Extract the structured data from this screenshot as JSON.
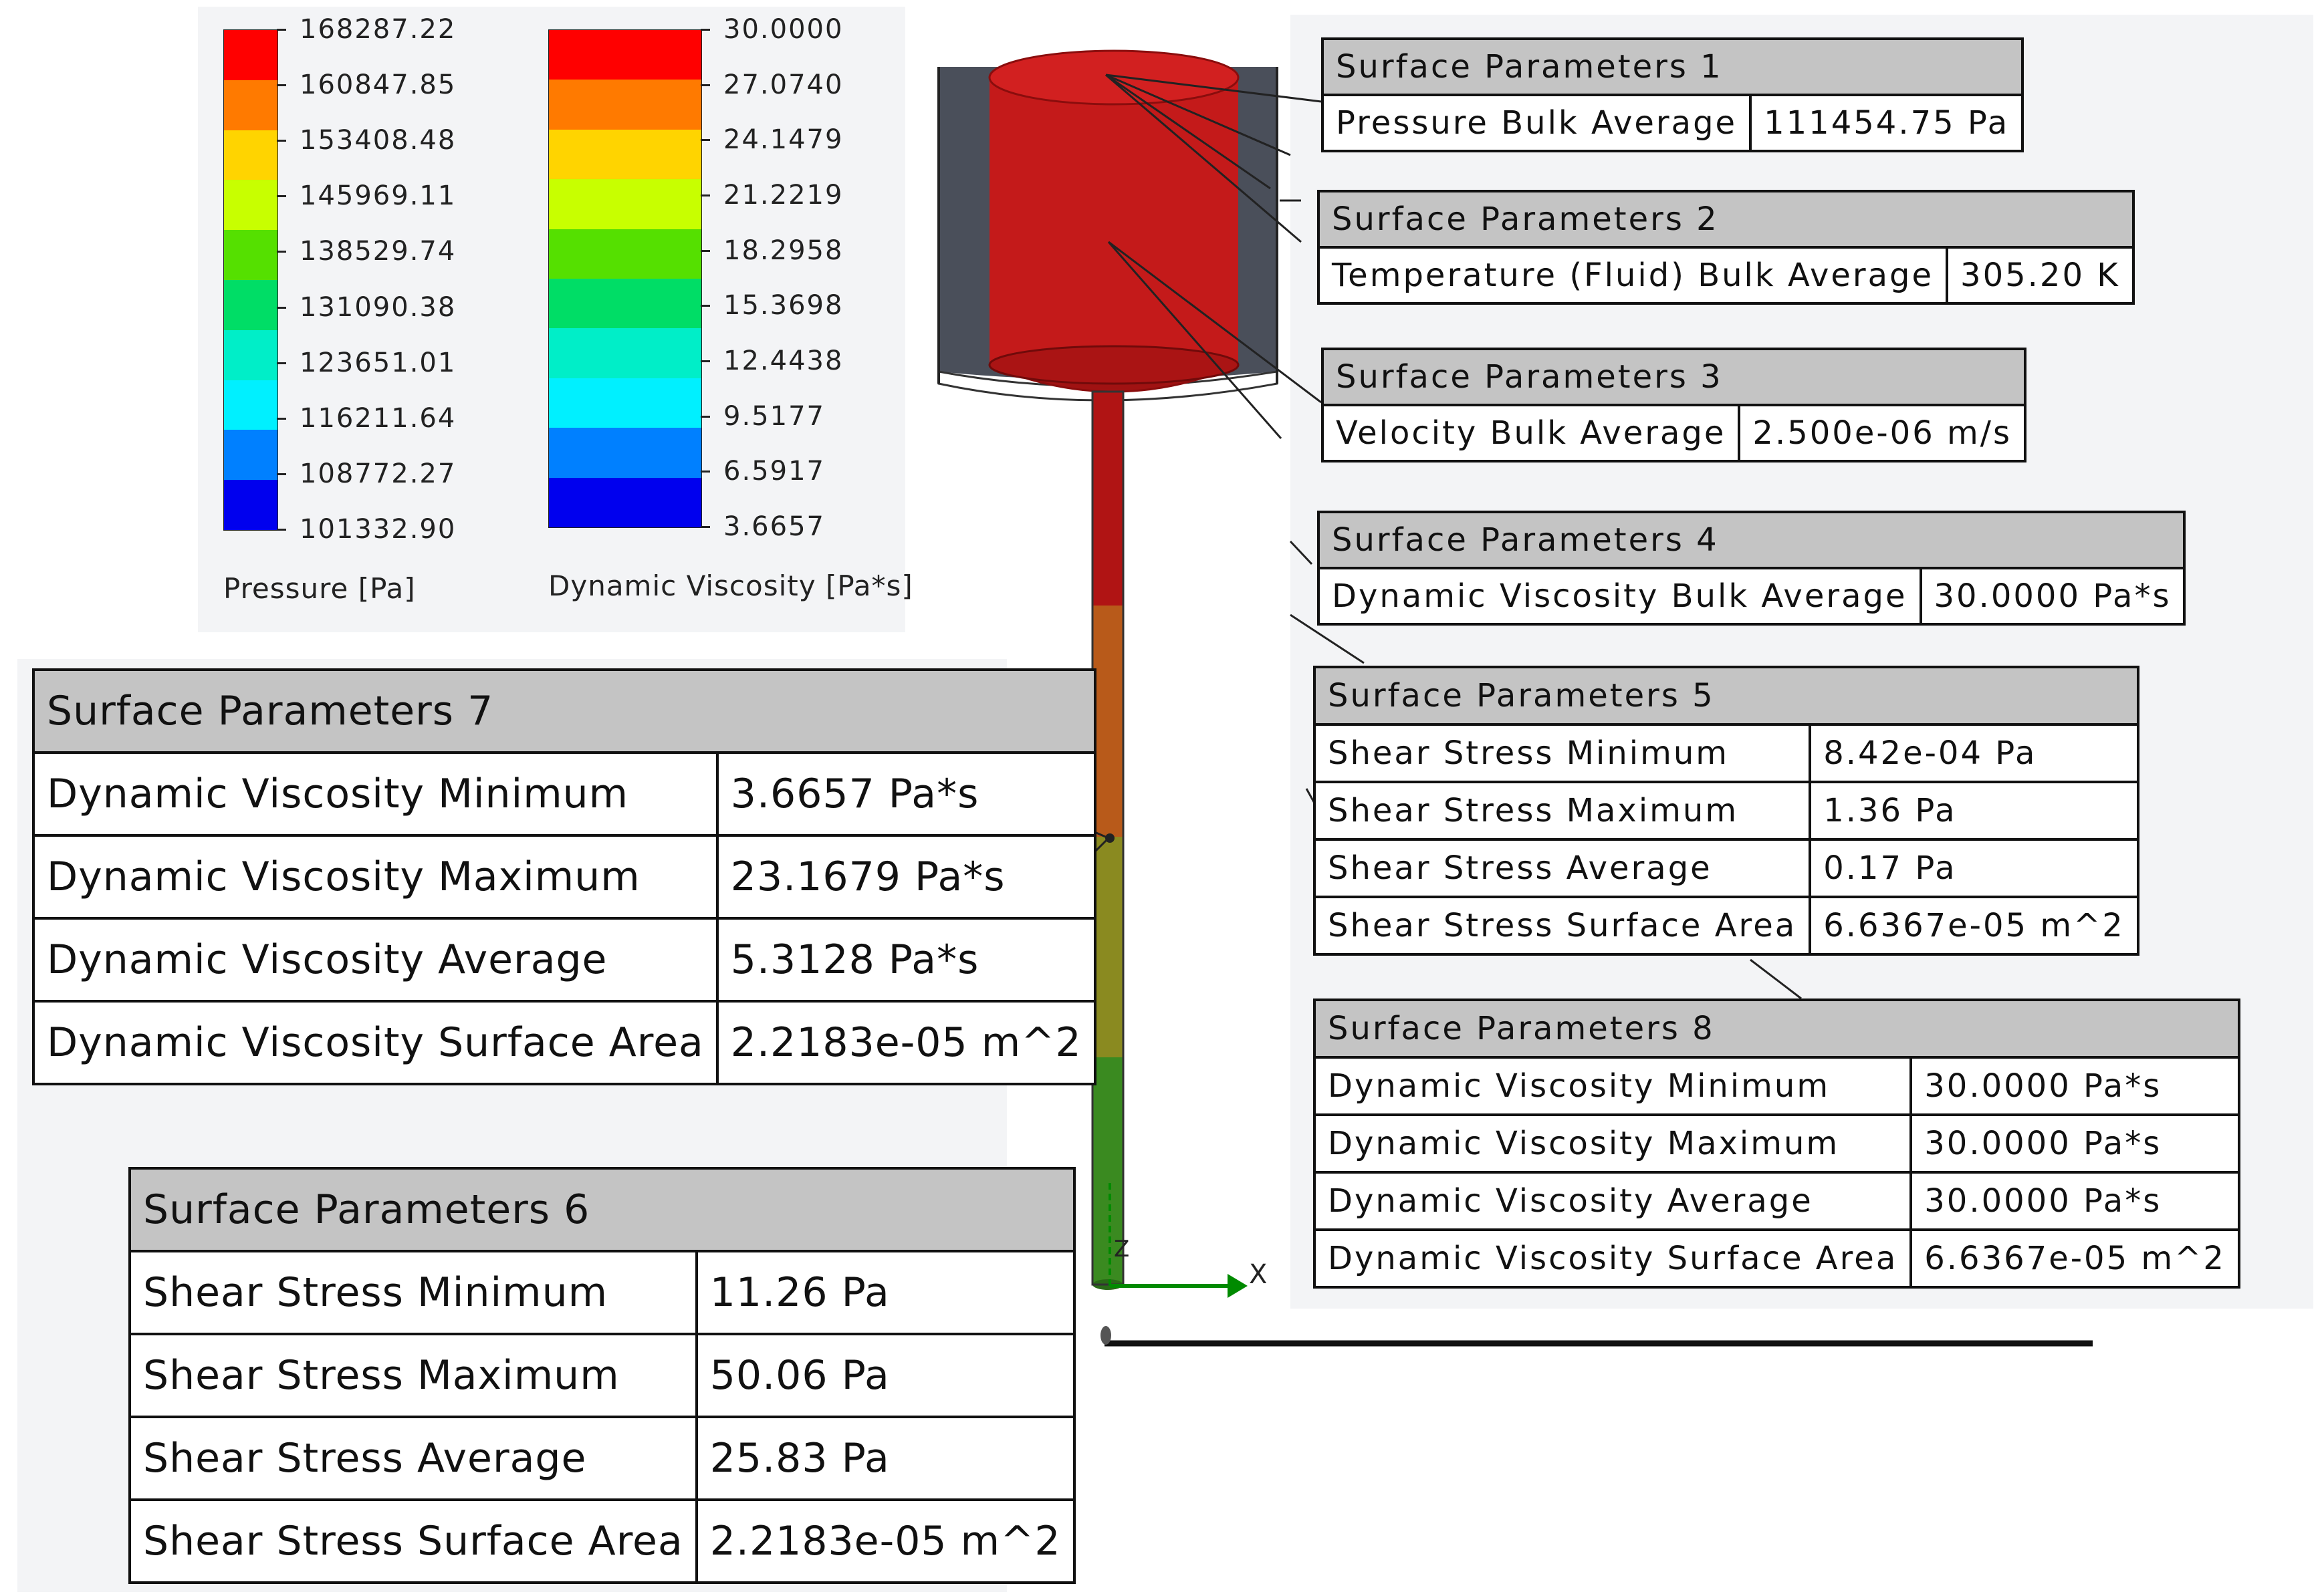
{
  "legends": [
    {
      "title": "Pressure [Pa]",
      "labels": [
        "168287.22",
        "160847.85",
        "153408.48",
        "145969.11",
        "138529.74",
        "131090.38",
        "123651.01",
        "116211.64",
        "108772.27",
        "101332.90"
      ],
      "colors": [
        "#ff0000",
        "#ff7a00",
        "#ffd400",
        "#c8ff00",
        "#55e000",
        "#00dd66",
        "#00eec8",
        "#00f0ff",
        "#0080ff",
        "#0000ee"
      ]
    },
    {
      "title": "Dynamic Viscosity [Pa*s]",
      "labels": [
        "30.0000",
        "27.0740",
        "24.1479",
        "21.2219",
        "18.2958",
        "15.3698",
        "12.4438",
        "9.5177",
        "6.5917",
        "3.6657"
      ],
      "colors": [
        "#ff0000",
        "#ff7a00",
        "#ffd400",
        "#c8ff00",
        "#55e000",
        "#00dd66",
        "#00eec8",
        "#00f0ff",
        "#0080ff",
        "#0000ee"
      ]
    }
  ],
  "tables": {
    "sp1": {
      "title": "Surface Parameters 1",
      "rows": [
        [
          "Pressure Bulk Average",
          "111454.75 Pa"
        ]
      ]
    },
    "sp2": {
      "title": "Surface Parameters 2",
      "rows": [
        [
          "Temperature (Fluid) Bulk Average",
          "305.20 K"
        ]
      ]
    },
    "sp3": {
      "title": "Surface Parameters 3",
      "rows": [
        [
          "Velocity Bulk Average",
          "2.500e-06 m/s"
        ]
      ]
    },
    "sp4": {
      "title": "Surface Parameters 4",
      "rows": [
        [
          "Dynamic Viscosity Bulk Average",
          "30.0000 Pa*s"
        ]
      ]
    },
    "sp5": {
      "title": "Surface Parameters 5",
      "rows": [
        [
          "Shear Stress Minimum",
          "8.42e-04 Pa"
        ],
        [
          "Shear Stress Maximum",
          "1.36 Pa"
        ],
        [
          "Shear Stress Average",
          "0.17 Pa"
        ],
        [
          "Shear Stress Surface Area",
          "6.6367e-05 m^2"
        ]
      ]
    },
    "sp8": {
      "title": "Surface Parameters 8",
      "rows": [
        [
          "Dynamic Viscosity Minimum",
          "30.0000 Pa*s"
        ],
        [
          "Dynamic Viscosity Maximum",
          "30.0000 Pa*s"
        ],
        [
          "Dynamic Viscosity Average",
          "30.0000 Pa*s"
        ],
        [
          "Dynamic Viscosity Surface Area",
          "6.6367e-05 m^2"
        ]
      ]
    },
    "sp7": {
      "title": "Surface Parameters 7",
      "rows": [
        [
          "Dynamic Viscosity Minimum",
          "3.6657 Pa*s"
        ],
        [
          "Dynamic Viscosity Maximum",
          "23.1679 Pa*s"
        ],
        [
          "Dynamic Viscosity Average",
          "5.3128 Pa*s"
        ],
        [
          "Dynamic Viscosity Surface Area",
          "2.2183e-05 m^2"
        ]
      ]
    },
    "sp6": {
      "title": "Surface Parameters 6",
      "rows": [
        [
          "Shear Stress Minimum",
          "11.26 Pa"
        ],
        [
          "Shear Stress Maximum",
          "50.06 Pa"
        ],
        [
          "Shear Stress Average",
          "25.83 Pa"
        ],
        [
          "Shear Stress Surface Area",
          "2.2183e-05 m^2"
        ]
      ]
    }
  },
  "axis": {
    "x_label": "X",
    "z_label": "Z"
  },
  "colors": {
    "reservoir_red": "#c41a1a",
    "housing_gray": "#4a4f5a",
    "stem_red": "#b01414",
    "stem_orange": "#b85a1a",
    "stem_olive": "#8a8a20",
    "stem_green": "#3a8a20",
    "axis_green": "#008a00"
  }
}
